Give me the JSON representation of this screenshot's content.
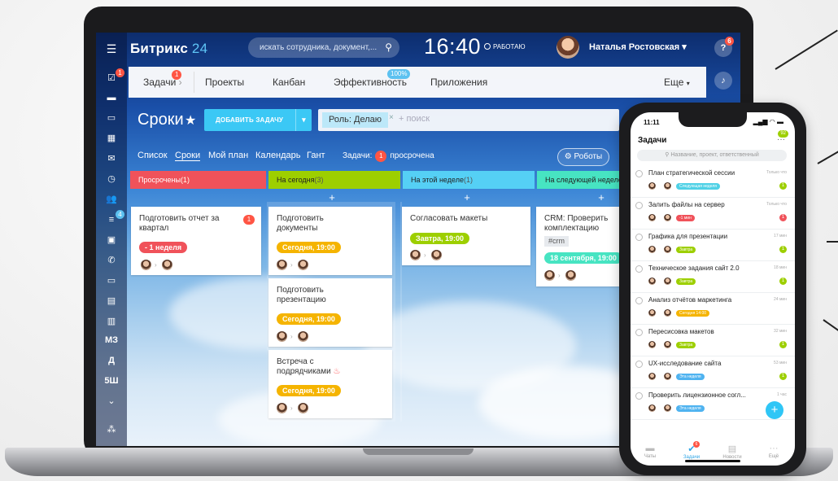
{
  "topbar": {
    "logo_main": "Битрикс",
    "logo_num": "24",
    "search_placeholder": "искать сотрудника, документ,...",
    "clock": "16:40",
    "status": "РАБОТАЮ",
    "user_name": "Наталья Ростовская",
    "help_badge": "6"
  },
  "menu": {
    "items": [
      "Задачи",
      "Проекты",
      "Канбан",
      "Эффективность",
      "Приложения"
    ],
    "tasks_badge": "1",
    "efficiency_badge": "100%",
    "more": "Еще"
  },
  "page": {
    "title": "Сроки",
    "add_button": "ДОБАВИТЬ ЗАДАЧУ",
    "filter_chip": "Роль: Делаю",
    "filter_placeholder": "+ поиск"
  },
  "view_tabs": [
    "Список",
    "Сроки",
    "Мой план",
    "Календарь",
    "Гант"
  ],
  "tasks_summary": {
    "label": "Задачи:",
    "count": "1",
    "text": "просрочена"
  },
  "robots_button": "Роботы",
  "rail": {
    "badges": [
      "1",
      "4"
    ],
    "labels": [
      "МЗ",
      "Д",
      "5Ш"
    ]
  },
  "columns": [
    {
      "title": "Просрочены",
      "count": "(1)",
      "color": "#f0525a"
    },
    {
      "title": "На сегодня",
      "count": "(3)",
      "color": "#9dcf00"
    },
    {
      "title": "На этой неделе",
      "count": "(1)",
      "color": "#55d0f5"
    },
    {
      "title": "На следующей неделе",
      "count": "",
      "color": "#47e4c2"
    }
  ],
  "cards": {
    "c1": {
      "title1": "Подготовить отчет за",
      "title2": "квартал",
      "tag": "- 1 неделя",
      "badge": "1"
    },
    "c2": {
      "title1": "Подготовить",
      "title2": "документы",
      "tag": "Сегодня, 19:00"
    },
    "c3": {
      "title1": "Подготовить",
      "title2": "презентацию",
      "tag": "Сегодня, 19:00"
    },
    "c4": {
      "title1": "Встреча с",
      "title2": "подрядчиками",
      "tag": "Сегодня, 19:00"
    },
    "c5": {
      "title1": "Согласовать макеты",
      "tag": "Завтра, 19:00"
    },
    "c6": {
      "title1": "CRM: Проверить",
      "title2": "комплектацию",
      "crm": "#crm",
      "tag": "18 сентября, 19:00"
    }
  },
  "phone": {
    "time": "11:11",
    "signal": "▂▄▆ ◠ ▬",
    "header": "Задачи",
    "badge": "92",
    "search": "Название, проект, ответственный",
    "rows": [
      {
        "title": "План стратегической сессии",
        "time": "Только что",
        "tag": "Следующая неделя",
        "tag_color": "#4fd1e6",
        "cnt": "1",
        "cnt_color": "#9dcf00"
      },
      {
        "title": "Залить файлы на сервер",
        "time": "Только что",
        "tag": "-1 мин",
        "tag_color": "#f0525a",
        "cnt": "1",
        "cnt_color": "#f0525a"
      },
      {
        "title": "Графика для презентации",
        "time": "17 мин",
        "tag": "Завтра",
        "tag_color": "#9dcf00",
        "cnt": "1",
        "cnt_color": "#9dcf00"
      },
      {
        "title": "Техническое задания сайт 2.0",
        "time": "18 мин",
        "tag": "Завтра",
        "tag_color": "#9dcf00",
        "cnt": "1",
        "cnt_color": "#9dcf00"
      },
      {
        "title": "Анализ отчётов маркетинга",
        "time": "24 мин",
        "tag": "Сегодня 14:00",
        "tag_color": "#f5b400",
        "cnt": "",
        "cnt_color": "#ffffff"
      },
      {
        "title": "Пересисовка макетов",
        "time": "32 мин",
        "tag": "Завтра",
        "tag_color": "#9dcf00",
        "cnt": "1",
        "cnt_color": "#9dcf00"
      },
      {
        "title": "UX-исследование сайта",
        "time": "53 мин",
        "tag": "Эта неделя",
        "tag_color": "#4fb3f0",
        "cnt": "1",
        "cnt_color": "#9dcf00"
      },
      {
        "title": "Проверить лицензионное согл...",
        "time": "1 час",
        "tag": "Эта неделя",
        "tag_color": "#4fb3f0",
        "cnt": "",
        "cnt_color": "#ffffff"
      }
    ],
    "tabs": [
      "Чаты",
      "Задачи",
      "Новости",
      "Ещё"
    ],
    "tasks_badge": "6"
  }
}
